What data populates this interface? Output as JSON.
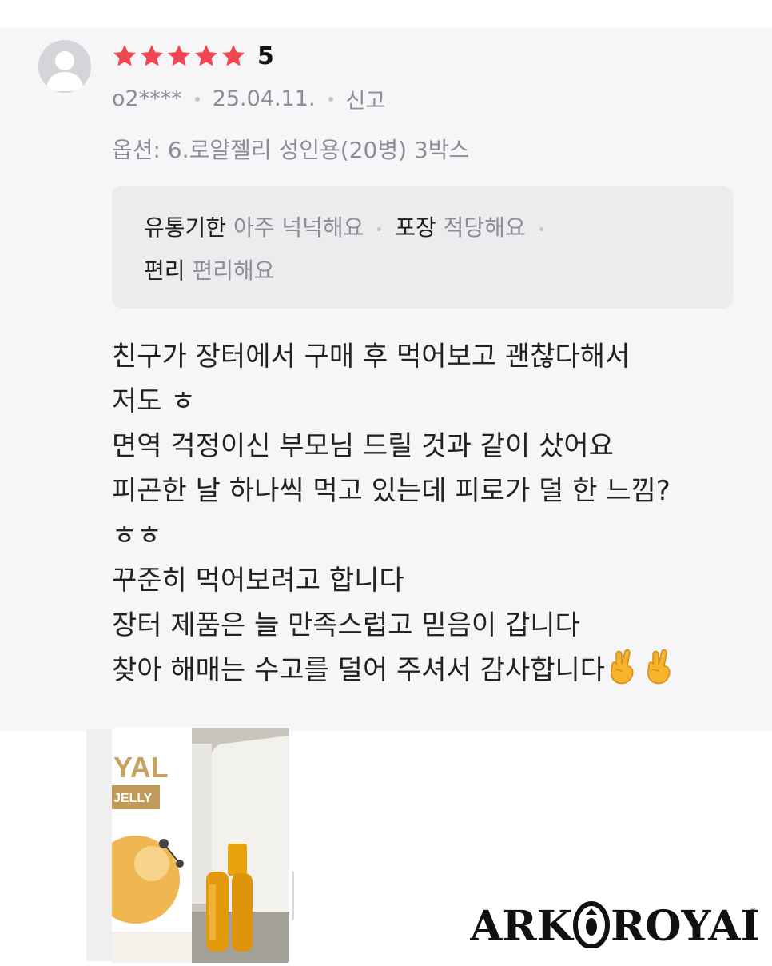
{
  "review": {
    "rating": "5",
    "stars": 5,
    "star_color": "#f14550",
    "user_id": "o2****",
    "date": "25.04.11.",
    "report_label": "신고",
    "option_text": "옵션: 6.로얄젤리 성인용(20병) 3박스",
    "tags": [
      {
        "key": "유통기한",
        "value": "아주 넉넉해요"
      },
      {
        "key": "포장",
        "value": "적당해요"
      },
      {
        "key": "편리",
        "value": "편리해요"
      }
    ],
    "body_lines": [
      "친구가 장터에서 구매 후 먹어보고 괜찮다해서",
      "저도 ㅎ",
      "면역 걱정이신 부모님 드릴 것과 같이 샀어요",
      "피곤한 날 하나씩 먹고 있는데 피로가 덜 한 느낌?",
      "ㅎㅎ",
      "꾸준히 먹어보려고 합니다",
      "장터 제품은 늘 만족스럽고 믿음이 갑니다",
      "찾아 해매는 수고를 덜어 주셔서 감사합니다"
    ],
    "emoji": "fingers-crossed-icon"
  },
  "photo": {
    "box_text": "YAL",
    "box_subtext": "JELLY"
  },
  "brand": {
    "left": "ARK",
    "right": "ROYAL",
    "mark": "®"
  }
}
